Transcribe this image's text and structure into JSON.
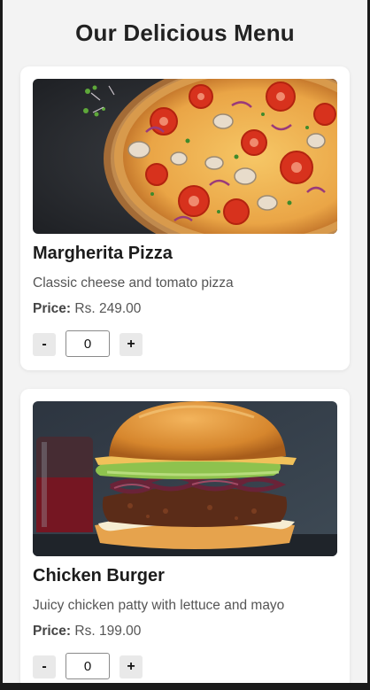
{
  "page": {
    "title": "Our Delicious Menu"
  },
  "items": [
    {
      "name": "Margherita Pizza",
      "description": "Classic cheese and tomato pizza",
      "price_label": "Price:",
      "price": "Rs. 249.00",
      "quantity": "0",
      "minus_label": "-",
      "plus_label": "+"
    },
    {
      "name": "Chicken Burger",
      "description": "Juicy chicken patty with lettuce and mayo",
      "price_label": "Price:",
      "price": "Rs. 199.00",
      "quantity": "0",
      "minus_label": "-",
      "plus_label": "+"
    }
  ],
  "colors": {
    "page_background": "#f3f3f3",
    "card_background": "#ffffff",
    "title_text": "#222222",
    "body_text": "#555555",
    "button_background": "#e9e9e9"
  }
}
